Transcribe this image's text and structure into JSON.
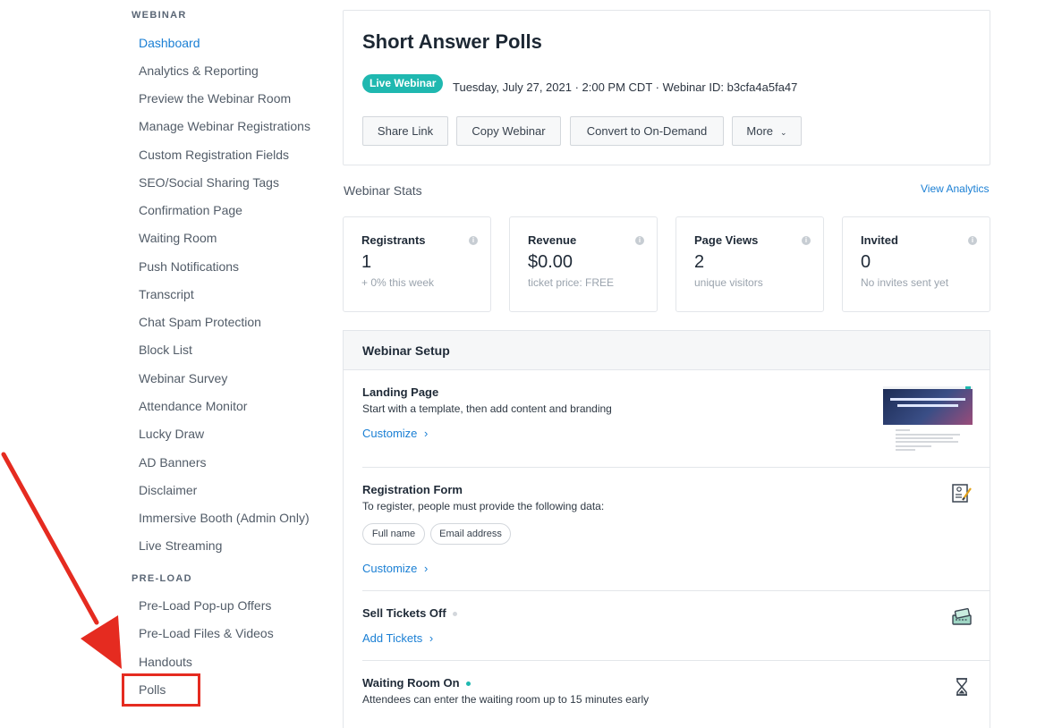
{
  "sidebar": {
    "webinar_heading": "WEBINAR",
    "items": [
      {
        "label": "Dashboard",
        "active": true
      },
      {
        "label": "Analytics & Reporting"
      },
      {
        "label": "Preview the Webinar Room"
      },
      {
        "label": "Manage Webinar Registrations"
      },
      {
        "label": "Custom Registration Fields"
      },
      {
        "label": "SEO/Social Sharing Tags"
      },
      {
        "label": "Confirmation Page"
      },
      {
        "label": "Waiting Room"
      },
      {
        "label": "Push Notifications"
      },
      {
        "label": "Transcript"
      },
      {
        "label": "Chat Spam Protection"
      },
      {
        "label": "Block List"
      },
      {
        "label": "Webinar Survey"
      },
      {
        "label": "Attendance Monitor"
      },
      {
        "label": "Lucky Draw"
      },
      {
        "label": "AD Banners"
      },
      {
        "label": "Disclaimer"
      },
      {
        "label": "Immersive Booth (Admin Only)"
      },
      {
        "label": "Live Streaming"
      }
    ],
    "preload_heading": "PRE-LOAD",
    "preload_items": [
      {
        "label": "Pre-Load Pop-up Offers"
      },
      {
        "label": "Pre-Load Files & Videos"
      },
      {
        "label": "Handouts"
      },
      {
        "label": "Polls",
        "highlighted": true
      }
    ]
  },
  "header": {
    "title": "Short Answer Polls",
    "badge": "Live Webinar",
    "meta": "Tuesday, July 27, 2021 · 2:00 PM CDT · Webinar ID: b3cfa4a5fa47",
    "buttons": {
      "share": "Share Link",
      "copy": "Copy Webinar",
      "convert": "Convert to On-Demand",
      "more": "More",
      "more_chevron": "⌄"
    }
  },
  "stats": {
    "heading": "Webinar Stats",
    "view_analytics": "View Analytics",
    "cards": [
      {
        "label": "Registrants",
        "value": "1",
        "sub": "+ 0% this week"
      },
      {
        "label": "Revenue",
        "value": "$0.00",
        "sub": "ticket price: FREE"
      },
      {
        "label": "Page Views",
        "value": "2",
        "sub": "unique visitors"
      },
      {
        "label": "Invited",
        "value": "0",
        "sub": "No invites sent yet"
      }
    ],
    "info_glyph": "i"
  },
  "setup": {
    "heading": "Webinar Setup",
    "landing": {
      "title": "Landing Page",
      "desc": "Start with a template, then add content and branding",
      "link": "Customize"
    },
    "registration": {
      "title": "Registration Form",
      "desc": "To register, people must provide the following data:",
      "fields": [
        "Full name",
        "Email address"
      ],
      "link": "Customize"
    },
    "tickets": {
      "title": "Sell Tickets Off",
      "link": "Add Tickets",
      "status_color": "#d3d7dc"
    },
    "waiting": {
      "title": "Waiting Room On",
      "desc": "Attendees can enter the waiting room up to 15 minutes early",
      "status_color": "#1fb8b0"
    },
    "link_chevron": "›"
  },
  "colors": {
    "accent": "#1a7fd4",
    "badge": "#1fb8b0",
    "annotation": "#e52b20"
  }
}
